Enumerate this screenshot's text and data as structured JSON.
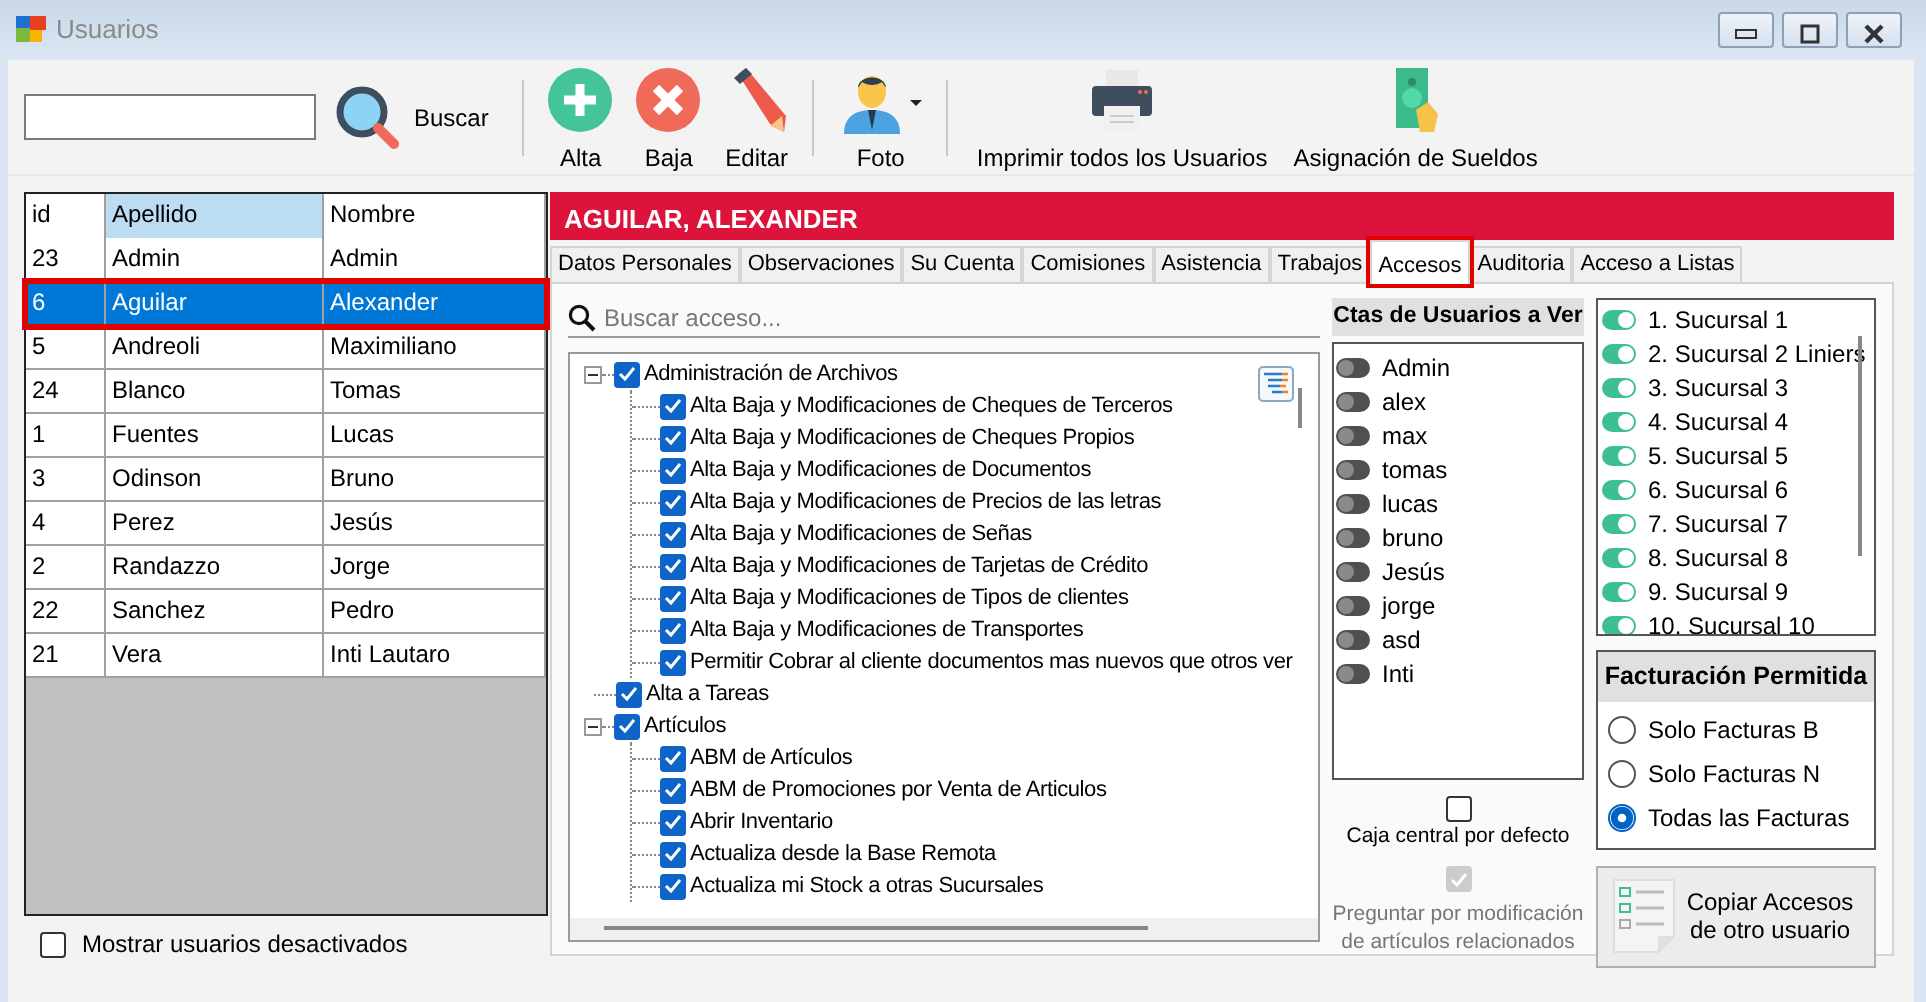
{
  "window": {
    "title": "Usuarios"
  },
  "toolbar": {
    "search_label": "Buscar",
    "buttons": [
      {
        "label": "Alta",
        "kind": "add",
        "separator_before": true
      },
      {
        "label": "Baja",
        "kind": "delete",
        "separator_before": false
      },
      {
        "label": "Editar",
        "kind": "edit",
        "separator_before": false
      },
      {
        "label": "Foto",
        "kind": "photo",
        "separator_before": true
      },
      {
        "label": "Imprimir todos los Usuarios",
        "kind": "print",
        "separator_before": true
      },
      {
        "label": "Asignación de Sueldos",
        "kind": "salary",
        "separator_before": false
      }
    ]
  },
  "users": {
    "columns": [
      {
        "label": "id",
        "selected": false
      },
      {
        "label": "Apellido",
        "selected": true
      },
      {
        "label": "Nombre",
        "selected": false
      }
    ],
    "rows": [
      {
        "cells": [
          "23",
          "Admin",
          "Admin"
        ],
        "selected": false
      },
      {
        "cells": [
          "6",
          "Aguilar",
          "Alexander"
        ],
        "selected": true
      },
      {
        "cells": [
          "5",
          "Andreoli",
          "Maximiliano"
        ],
        "selected": false
      },
      {
        "cells": [
          "24",
          "Blanco",
          "Tomas"
        ],
        "selected": false
      },
      {
        "cells": [
          "1",
          "Fuentes",
          "Lucas"
        ],
        "selected": false
      },
      {
        "cells": [
          "3",
          "Odinson",
          "Bruno"
        ],
        "selected": false
      },
      {
        "cells": [
          "4",
          "Perez",
          "Jesús"
        ],
        "selected": false
      },
      {
        "cells": [
          "2",
          "Randazzo",
          "Jorge"
        ],
        "selected": false
      },
      {
        "cells": [
          "22",
          "Sanchez",
          "Pedro"
        ],
        "selected": false
      },
      {
        "cells": [
          "21",
          "Vera",
          "Inti Lautaro"
        ],
        "selected": false
      }
    ],
    "show_inactive": {
      "label": "Mostrar usuarios desactivados",
      "checked": false
    }
  },
  "detail": {
    "title": "AGUILAR, ALEXANDER",
    "tabs": [
      {
        "label": "Datos Personales",
        "selected": false
      },
      {
        "label": "Observaciones",
        "selected": false
      },
      {
        "label": "Su Cuenta",
        "selected": false
      },
      {
        "label": "Comisiones",
        "selected": false
      },
      {
        "label": "Asistencia",
        "selected": false
      },
      {
        "label": "Trabajos",
        "selected": false
      },
      {
        "label": "Accesos",
        "selected": true
      },
      {
        "label": "Auditoria",
        "selected": false
      },
      {
        "label": "Acceso a Listas",
        "selected": false
      }
    ],
    "search": {
      "placeholder": "Buscar acceso..."
    },
    "tree": [
      {
        "label": "Administración de Archivos",
        "checked": true,
        "expanded": true,
        "children": [
          {
            "label": "Alta Baja y Modificaciones de Cheques de Terceros",
            "checked": true
          },
          {
            "label": "Alta Baja y Modificaciones de Cheques Propios",
            "checked": true
          },
          {
            "label": "Alta Baja y Modificaciones de Documentos",
            "checked": true
          },
          {
            "label": "Alta Baja y Modificaciones de Precios de las letras",
            "checked": true
          },
          {
            "label": "Alta Baja y Modificaciones de Señas",
            "checked": true
          },
          {
            "label": "Alta Baja y Modificaciones de Tarjetas de Crédito",
            "checked": true
          },
          {
            "label": "Alta Baja y Modificaciones de Tipos de clientes",
            "checked": true
          },
          {
            "label": "Alta Baja y Modificaciones de Transportes",
            "checked": true
          },
          {
            "label": "Permitir Cobrar al cliente documentos mas nuevos que otros ver",
            "checked": true
          }
        ]
      },
      {
        "label": "Alta a Tareas",
        "checked": true
      },
      {
        "label": "Artículos",
        "checked": true,
        "expanded": true,
        "children": [
          {
            "label": "ABM de Artículos",
            "checked": true
          },
          {
            "label": "ABM de Promociones por Venta de Articulos",
            "checked": true
          },
          {
            "label": "Abrir Inventario",
            "checked": true
          },
          {
            "label": "Actualiza desde la Base Remota",
            "checked": true
          },
          {
            "label": "Actualiza mi Stock a otras Sucursales",
            "checked": true
          }
        ]
      }
    ],
    "accounts": {
      "title": "Ctas de Usuarios a Ver",
      "items": [
        {
          "label": "Admin",
          "on": false
        },
        {
          "label": "alex",
          "on": false
        },
        {
          "label": "max",
          "on": false
        },
        {
          "label": "tomas",
          "on": false
        },
        {
          "label": "lucas",
          "on": false
        },
        {
          "label": "bruno",
          "on": false
        },
        {
          "label": "Jesús",
          "on": false
        },
        {
          "label": "jorge",
          "on": false
        },
        {
          "label": "asd",
          "on": false
        },
        {
          "label": "Inti",
          "on": false
        }
      ]
    },
    "default_cash": {
      "label": "Caja central por defecto",
      "checked": false,
      "disabled": false
    },
    "ask_related": {
      "lines": [
        "Preguntar por modificación",
        "de artículos relacionados"
      ],
      "checked": true,
      "disabled": true
    },
    "branches": [
      {
        "label": "1. Sucursal 1",
        "on": true
      },
      {
        "label": "2. Sucursal 2 Liniers",
        "on": true
      },
      {
        "label": "3. Sucursal 3",
        "on": true
      },
      {
        "label": "4. Sucursal 4",
        "on": true
      },
      {
        "label": "5. Sucursal 5",
        "on": true
      },
      {
        "label": "6. Sucursal 6",
        "on": true
      },
      {
        "label": "7. Sucursal 7",
        "on": true
      },
      {
        "label": "8. Sucursal 8",
        "on": true
      },
      {
        "label": "9. Sucursal 9",
        "on": true
      },
      {
        "label": "10. Sucursal 10",
        "on": true
      }
    ],
    "billing": {
      "title": "Facturación Permitida",
      "options": [
        {
          "label": "Solo Facturas B",
          "selected": false
        },
        {
          "label": "Solo Facturas N",
          "selected": false
        },
        {
          "label": "Todas las Facturas",
          "selected": true
        }
      ]
    },
    "copy_button": {
      "lines": [
        "Copiar Accesos",
        "de otro usuario"
      ]
    }
  }
}
